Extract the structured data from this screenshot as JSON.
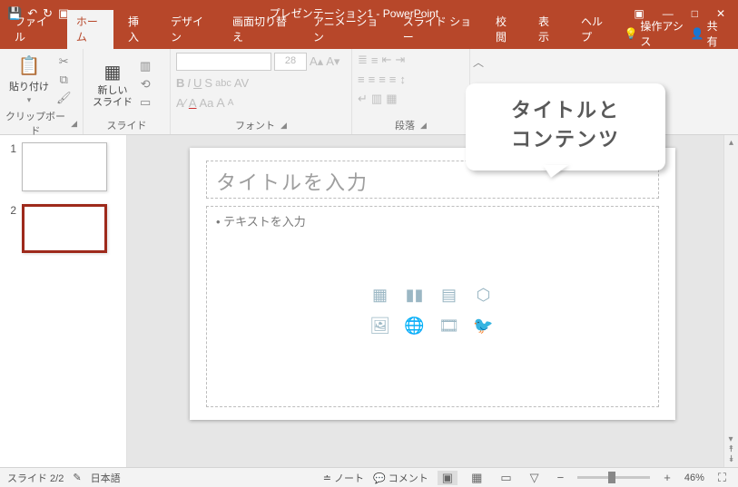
{
  "titlebar": {
    "title": "プレゼンテーション1 - PowerPoint"
  },
  "tabs": {
    "file": "ファイル",
    "home": "ホーム",
    "insert": "挿入",
    "design": "デザイン",
    "transitions": "画面切り替え",
    "animations": "アニメーション",
    "slideshow": "スライド ショー",
    "review": "校閲",
    "view": "表示",
    "help": "ヘルプ",
    "tellme": "操作アシス",
    "share": "共有"
  },
  "ribbon": {
    "clipboard": {
      "paste": "貼り付け",
      "label": "クリップボード"
    },
    "slides": {
      "new": "新しい\nスライド",
      "label": "スライド"
    },
    "font": {
      "size": "28",
      "label": "フォント"
    },
    "paragraph": {
      "label": "段落"
    }
  },
  "thumbs": {
    "n1": "1",
    "n2": "2"
  },
  "slide": {
    "title_placeholder": "タイトルを入力",
    "body_placeholder": "• テキストを入力"
  },
  "callout": {
    "line1": "タイトルと",
    "line2": "コンテンツ"
  },
  "status": {
    "slide": "スライド 2/2",
    "lang": "日本語",
    "notes": "ノート",
    "comments": "コメント",
    "zoom": "46%"
  }
}
